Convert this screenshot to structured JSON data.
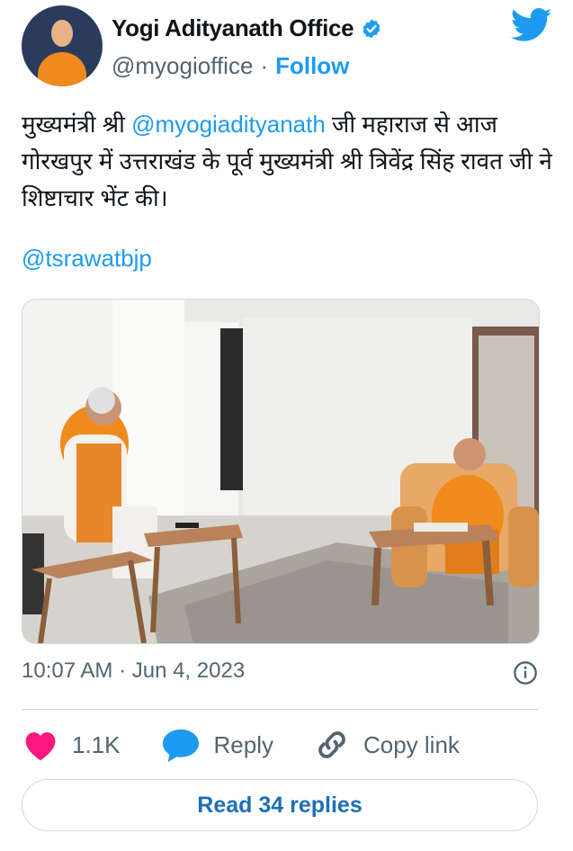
{
  "author": {
    "name": "Yogi Adityanath Office",
    "handle": "@myogioffice",
    "separator": "·",
    "follow_label": "Follow",
    "verified_color": "#1d9bf0"
  },
  "tweet": {
    "text_before": "मुख्यमंत्री श्री ",
    "mention_1": "@myogiadityanath",
    "text_after": " जी महाराज से आज गोरखपुर में उत्तराखंड के पूर्व मुख्यमंत्री श्री त्रिवेंद्र सिंह रावत जी ने शिष्टाचार भेंट की।",
    "mention_2": "@tsrawatbjp"
  },
  "meta": {
    "time": "10:07 AM",
    "separator": "·",
    "date": "Jun 4, 2023"
  },
  "actions": {
    "like_count": "1.1K",
    "reply_label": "Reply",
    "copy_label": "Copy link"
  },
  "read_replies_label": "Read 34 replies",
  "icons": {
    "logo": "twitter-bird-icon",
    "verified": "verified-badge-icon",
    "info": "info-icon",
    "like": "heart-icon",
    "reply": "speech-bubble-icon",
    "copy": "link-icon"
  },
  "colors": {
    "brand": "#1d9bf0",
    "like": "#f91880",
    "text": "#0f1419",
    "muted": "#536471"
  }
}
